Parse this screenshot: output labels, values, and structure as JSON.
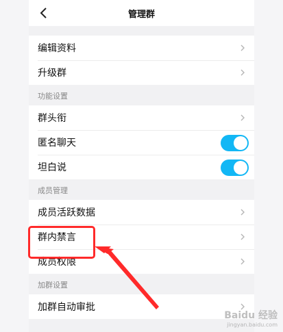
{
  "header": {
    "title": "管理群"
  },
  "group1": [
    {
      "label": "编辑资料"
    },
    {
      "label": "升级群"
    }
  ],
  "sections": {
    "function": {
      "title": "功能设置",
      "items": [
        {
          "label": "群头衔",
          "type": "chevron"
        },
        {
          "label": "匿名聊天",
          "type": "toggle",
          "on": true
        },
        {
          "label": "坦白说",
          "type": "toggle",
          "on": true
        }
      ]
    },
    "members": {
      "title": "成员管理",
      "items": [
        {
          "label": "成员活跃数据"
        },
        {
          "label": "群内禁言"
        },
        {
          "label": "成员权限"
        }
      ]
    },
    "join": {
      "title": "加群设置",
      "items": [
        {
          "label": "加群自动审批"
        }
      ]
    }
  },
  "watermark": {
    "logo": "Baidu 经验",
    "site": "jingyan.baidu.com"
  },
  "colors": {
    "toggle": "#12b7f5",
    "annotation": "#ff2a2a"
  },
  "icons": {
    "back": "chevron-left-icon",
    "row": "chevron-right-icon"
  }
}
